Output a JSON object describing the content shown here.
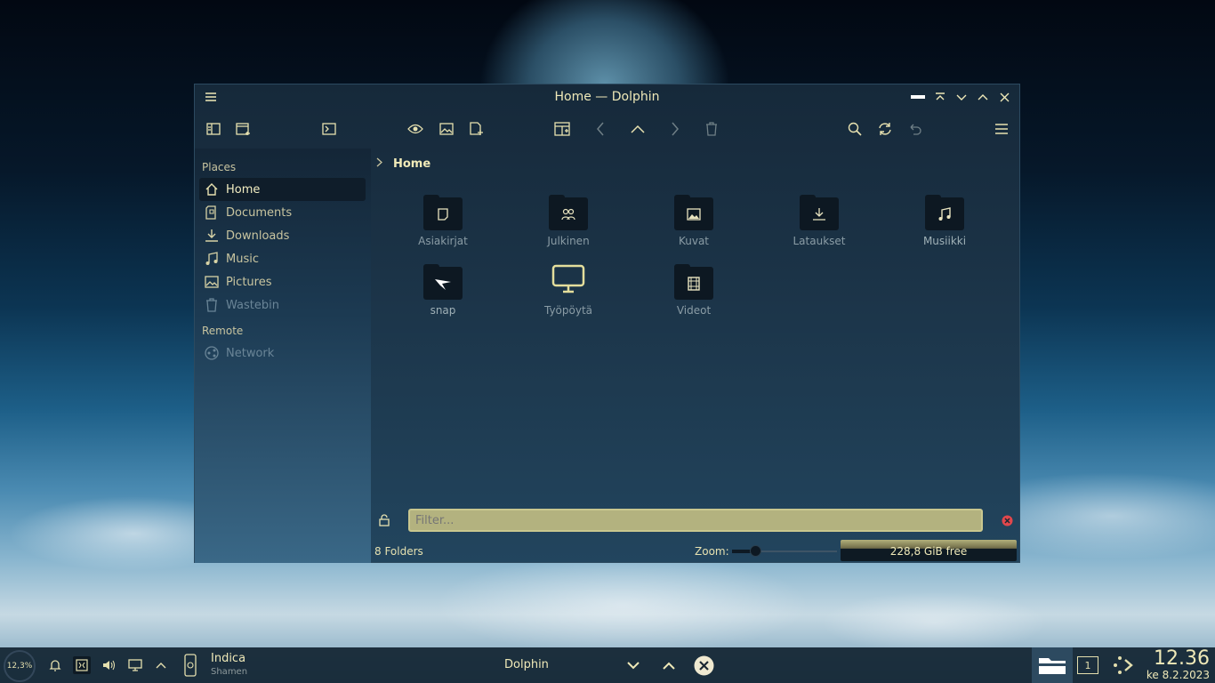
{
  "window": {
    "title": "Home — Dolphin"
  },
  "sidebar": {
    "places_header": "Places",
    "places": [
      {
        "label": "Home",
        "icon": "home-icon",
        "active": true
      },
      {
        "label": "Documents",
        "icon": "documents-icon"
      },
      {
        "label": "Downloads",
        "icon": "downloads-icon"
      },
      {
        "label": "Music",
        "icon": "music-icon"
      },
      {
        "label": "Pictures",
        "icon": "pictures-icon"
      },
      {
        "label": "Wastebin",
        "icon": "trash-icon"
      }
    ],
    "remote_header": "Remote",
    "remote": [
      {
        "label": "Network",
        "icon": "network-icon"
      }
    ]
  },
  "breadcrumb": {
    "current": "Home"
  },
  "items": [
    {
      "label": "Asiakirjat",
      "icon": "document-folder-icon"
    },
    {
      "label": "Julkinen",
      "icon": "public-folder-icon"
    },
    {
      "label": "Kuvat",
      "icon": "pictures-folder-icon"
    },
    {
      "label": "Lataukset",
      "icon": "downloads-folder-icon"
    },
    {
      "label": "Musiikki",
      "icon": "music-folder-icon"
    },
    {
      "label": "snap",
      "icon": "snap-folder-icon"
    },
    {
      "label": "Työpöytä",
      "icon": "desktop-icon"
    },
    {
      "label": "Videot",
      "icon": "videos-folder-icon"
    }
  ],
  "filter": {
    "placeholder": "Filter..."
  },
  "status": {
    "folders": "8 Folders",
    "zoom_label": "Zoom:",
    "zoom_level": 0.22,
    "free_space": "228,8 GiB free",
    "disk_used_fraction": 0.5
  },
  "taskbar": {
    "cpu": "12,3%",
    "media_title": "Indica",
    "media_artist": "Shamen",
    "active_window": "Dolphin",
    "desktop_number": "1",
    "time": "12.36",
    "date": "ke 8.2.2023"
  },
  "colors": {
    "accent": "#efe9b8",
    "window_bg": "#1b3347",
    "filter_bg": "#b3b27f",
    "close_red": "#e0474c"
  }
}
